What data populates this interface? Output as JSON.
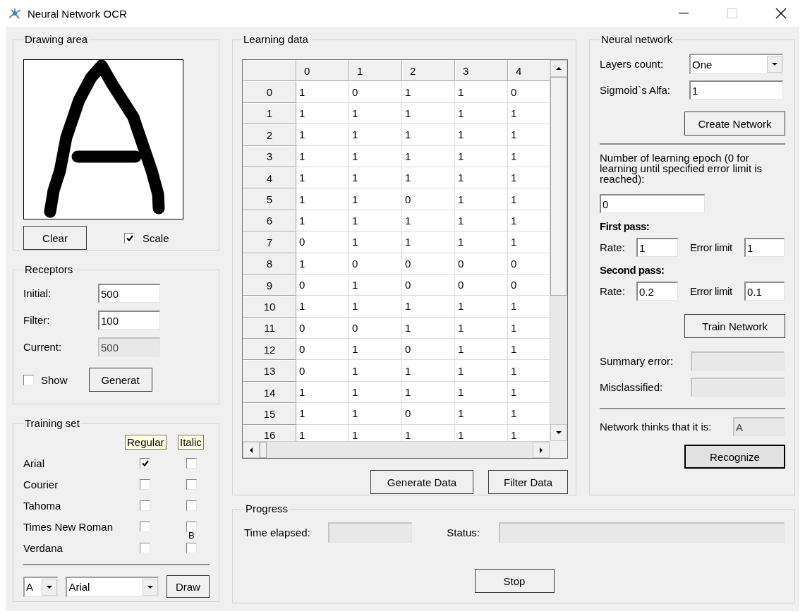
{
  "window": {
    "title": "Neural Network OCR"
  },
  "drawing_area": {
    "title": "Drawing area",
    "clear_button": "Clear",
    "scale": {
      "label": "Scale",
      "checked": true
    }
  },
  "receptors": {
    "title": "Receptors",
    "fields": [
      {
        "label": "Initial:",
        "value": "500",
        "disabled": false
      },
      {
        "label": "Filter:",
        "value": "100",
        "disabled": false
      },
      {
        "label": "Current:",
        "value": "500",
        "disabled": true
      }
    ],
    "show": {
      "label": "Show",
      "checked": false
    },
    "generate_button": "Generat"
  },
  "training_set": {
    "title": "Training set",
    "columns": [
      "Regular",
      "Italic"
    ],
    "fonts": [
      {
        "name": "Arial",
        "regular": true,
        "italic": false
      },
      {
        "name": "Courier",
        "regular": false,
        "italic": false
      },
      {
        "name": "Tahoma",
        "regular": false,
        "italic": false
      },
      {
        "name": "Times New Roman",
        "regular": false,
        "italic": false,
        "overlay": "B"
      },
      {
        "name": "Verdana",
        "regular": false,
        "italic": false
      }
    ],
    "letter": "A",
    "font": "Arial",
    "draw_button": "Draw"
  },
  "learning_data": {
    "title": "Learning data",
    "columns": [
      "0",
      "1",
      "2",
      "3",
      "4"
    ],
    "rows": [
      {
        "header": "0",
        "cells": [
          "1",
          "0",
          "1",
          "1",
          "0"
        ]
      },
      {
        "header": "1",
        "cells": [
          "1",
          "1",
          "1",
          "1",
          "1"
        ]
      },
      {
        "header": "2",
        "cells": [
          "1",
          "1",
          "1",
          "1",
          "1"
        ]
      },
      {
        "header": "3",
        "cells": [
          "1",
          "1",
          "1",
          "1",
          "1"
        ]
      },
      {
        "header": "4",
        "cells": [
          "1",
          "1",
          "1",
          "1",
          "1"
        ]
      },
      {
        "header": "5",
        "cells": [
          "1",
          "1",
          "0",
          "1",
          "1"
        ]
      },
      {
        "header": "6",
        "cells": [
          "1",
          "1",
          "1",
          "1",
          "1"
        ]
      },
      {
        "header": "7",
        "cells": [
          "0",
          "1",
          "1",
          "1",
          "1"
        ]
      },
      {
        "header": "8",
        "cells": [
          "1",
          "0",
          "0",
          "0",
          "0"
        ]
      },
      {
        "header": "9",
        "cells": [
          "0",
          "1",
          "0",
          "0",
          "0"
        ]
      },
      {
        "header": "10",
        "cells": [
          "1",
          "1",
          "1",
          "1",
          "1"
        ]
      },
      {
        "header": "11",
        "cells": [
          "0",
          "0",
          "1",
          "1",
          "1"
        ]
      },
      {
        "header": "12",
        "cells": [
          "0",
          "1",
          "0",
          "1",
          "1"
        ]
      },
      {
        "header": "13",
        "cells": [
          "0",
          "1",
          "1",
          "1",
          "1"
        ]
      },
      {
        "header": "14",
        "cells": [
          "1",
          "1",
          "1",
          "1",
          "1"
        ]
      },
      {
        "header": "15",
        "cells": [
          "1",
          "1",
          "0",
          "1",
          "1"
        ]
      },
      {
        "header": "16",
        "cells": [
          "1",
          "1",
          "1",
          "1",
          "1"
        ]
      }
    ],
    "buttons": [
      "Generate Data",
      "Filter Data"
    ]
  },
  "neural_network": {
    "title": "Neural network",
    "layers_count": {
      "label": "Layers count:",
      "value": "One"
    },
    "sigmoid_alfa": {
      "label": "Sigmoid`s Alfa:",
      "value": "1"
    },
    "create_button": "Create Network",
    "epoch_note": "Number of learning epoch (0 for learning until specified error limit is reached):",
    "epochs": "0",
    "passes": [
      {
        "title": "First pass:",
        "rate_label": "Rate:",
        "rate": "1",
        "error_label": "Error limit",
        "error": "1"
      },
      {
        "title": "Second pass:",
        "rate_label": "Rate:",
        "rate": "0.2",
        "error_label": "Error limit",
        "error": "0.1"
      }
    ],
    "train_button": "Train Network",
    "summary_error": {
      "label": "Summary error:",
      "disabled": true
    },
    "misclassified": {
      "label": "Misclassified:",
      "disabled": true
    },
    "result": {
      "label": "Network thinks that it is:",
      "value": "A",
      "disabled": true
    },
    "recognize_button": {
      "label": "Recognize",
      "default": true
    }
  },
  "progress": {
    "title": "Progress",
    "time_elapsed": {
      "label": "Time elapsed:",
      "disabled": true
    },
    "status": {
      "label": "Status:",
      "disabled": true
    },
    "stop_button": "Stop"
  }
}
